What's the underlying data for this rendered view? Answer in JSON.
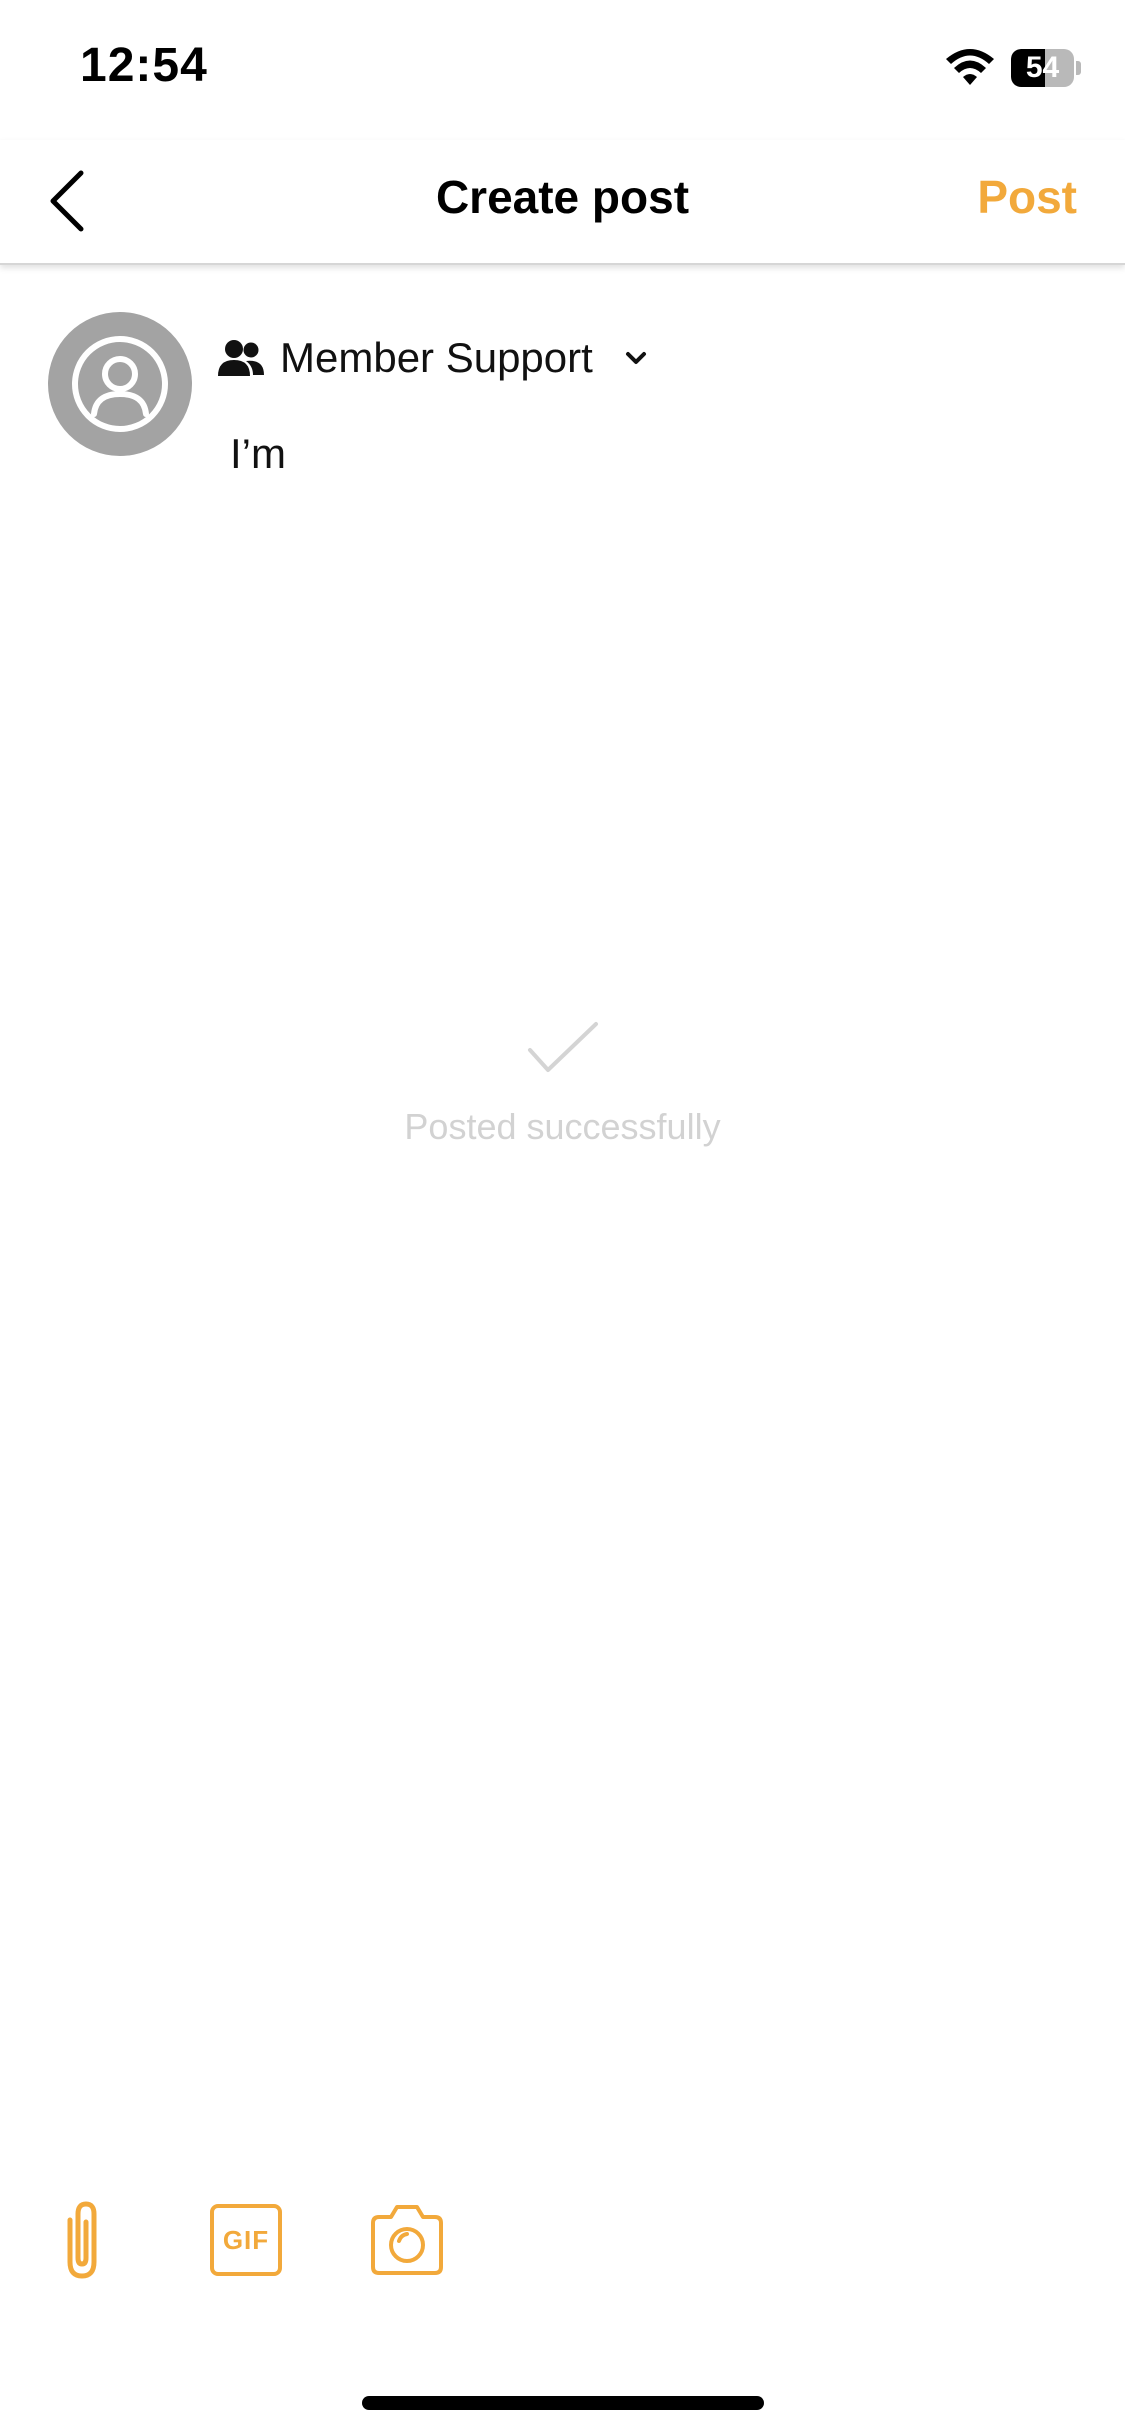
{
  "status_bar": {
    "time": "12:54",
    "battery_level": "54",
    "battery_fraction": 0.54
  },
  "nav": {
    "title": "Create post",
    "post_label": "Post"
  },
  "composer": {
    "audience_label": "Member Support",
    "text": "I’m"
  },
  "toast": {
    "message": "Posted successfully"
  },
  "toolbar": {
    "gif_label": "GIF"
  },
  "icons": {
    "back": "chevron-left-icon",
    "avatar": "user-circle-icon",
    "audience": "group-icon",
    "dropdown": "chevron-down-icon",
    "toast": "check-icon",
    "attach": "paperclip-icon",
    "gif": "gif-icon",
    "camera": "camera-icon"
  },
  "colors": {
    "accent": "#f2a93b",
    "avatar_bg": "#a3a3a3",
    "toast_text": "#d2d2d2"
  }
}
